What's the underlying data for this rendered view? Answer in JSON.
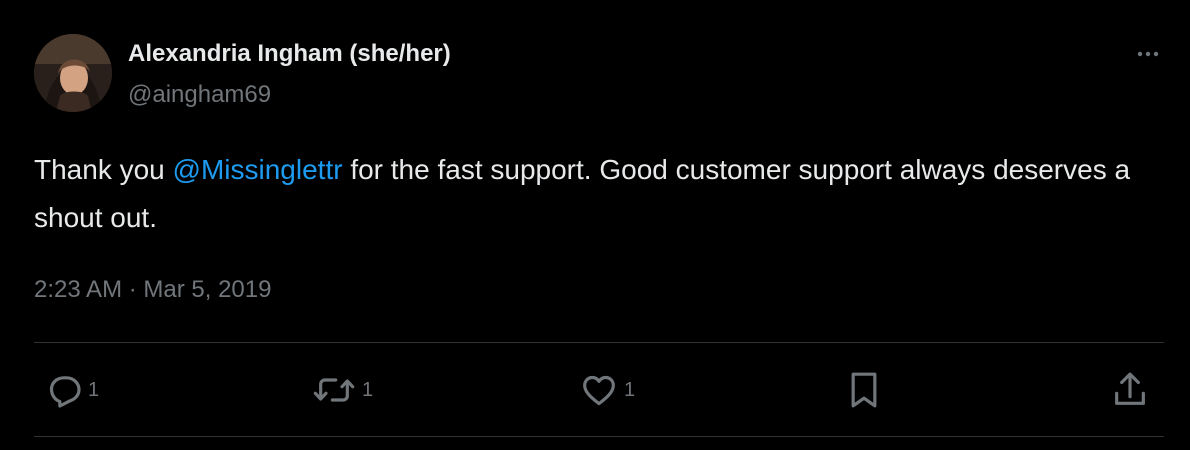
{
  "author": {
    "display_name": "Alexandria Ingham (she/her)",
    "handle": "@aingham69"
  },
  "tweet": {
    "text_before": "Thank you ",
    "mention": "@Missinglettr",
    "text_after": " for the fast support. Good customer support always deserves a shout out.",
    "timestamp": "2:23 AM · Mar 5, 2019"
  },
  "actions": {
    "reply_count": "1",
    "retweet_count": "1",
    "like_count": "1"
  },
  "icons": {
    "more": "more-horizontal-icon",
    "reply": "reply-icon",
    "retweet": "retweet-icon",
    "like": "heart-icon",
    "bookmark": "bookmark-icon",
    "share": "share-icon"
  },
  "colors": {
    "background": "#000000",
    "text": "#e7e9ea",
    "secondary": "#71767b",
    "link": "#1d9bf0",
    "divider": "#2f3336"
  }
}
